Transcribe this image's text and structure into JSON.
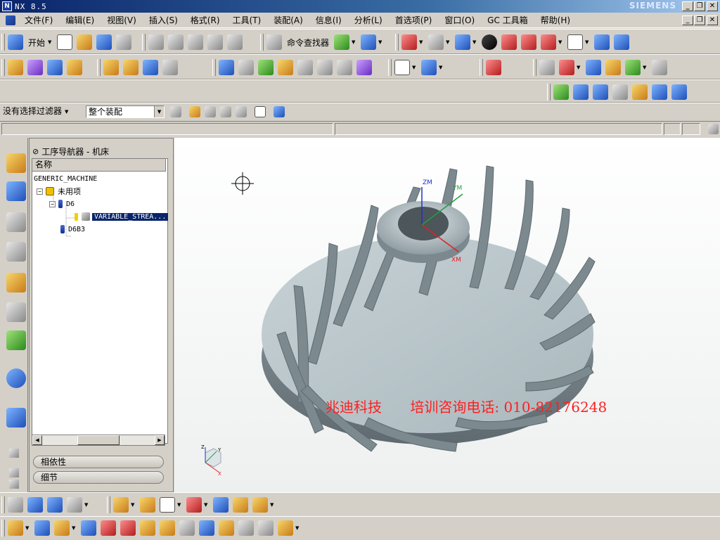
{
  "window": {
    "title": "NX 8.5",
    "brand": "SIEMENS",
    "app_icon": "nx-icon",
    "minimize_glyph": "_",
    "restore_glyph": "❐",
    "close_glyph": "✕"
  },
  "menubar": {
    "items": [
      "文件(F)",
      "编辑(E)",
      "视图(V)",
      "插入(S)",
      "格式(R)",
      "工具(T)",
      "装配(A)",
      "信息(I)",
      "分析(L)",
      "首选项(P)",
      "窗口(O)",
      "GC 工具箱",
      "帮助(H)"
    ]
  },
  "toolbar": {
    "start_label": "开始",
    "finder_label": "命令查找器"
  },
  "filterbar": {
    "selection_filter": "没有选择过滤器",
    "scope": "整个装配"
  },
  "navigator": {
    "title": "工序导航器 - 机床",
    "column_header": "名称",
    "tree": [
      {
        "label": "GENERIC_MACHINE",
        "level": 0
      },
      {
        "label": "未用项",
        "level": 1,
        "expander": "⊟"
      },
      {
        "label": "D6",
        "level": 2,
        "expander": "⊟"
      },
      {
        "label": "VARIABLE_STREA...",
        "level": 3,
        "selected": true
      },
      {
        "label": "D6B3",
        "level": 2
      }
    ],
    "dependencies_label": "相依性",
    "details_label": "细节"
  },
  "viewport": {
    "csys_labels": {
      "z": "ZM",
      "y": "YM",
      "x": "XM"
    },
    "triad_labels": {
      "z": "Z",
      "y": "Y",
      "x": "X"
    },
    "watermark_company": "兆迪科技",
    "watermark_phone": "培训咨询电话: 010-82176248"
  },
  "colors": {
    "accent": "#0a246a",
    "watermark": "#ff2020",
    "part": "#b8c4c8"
  }
}
